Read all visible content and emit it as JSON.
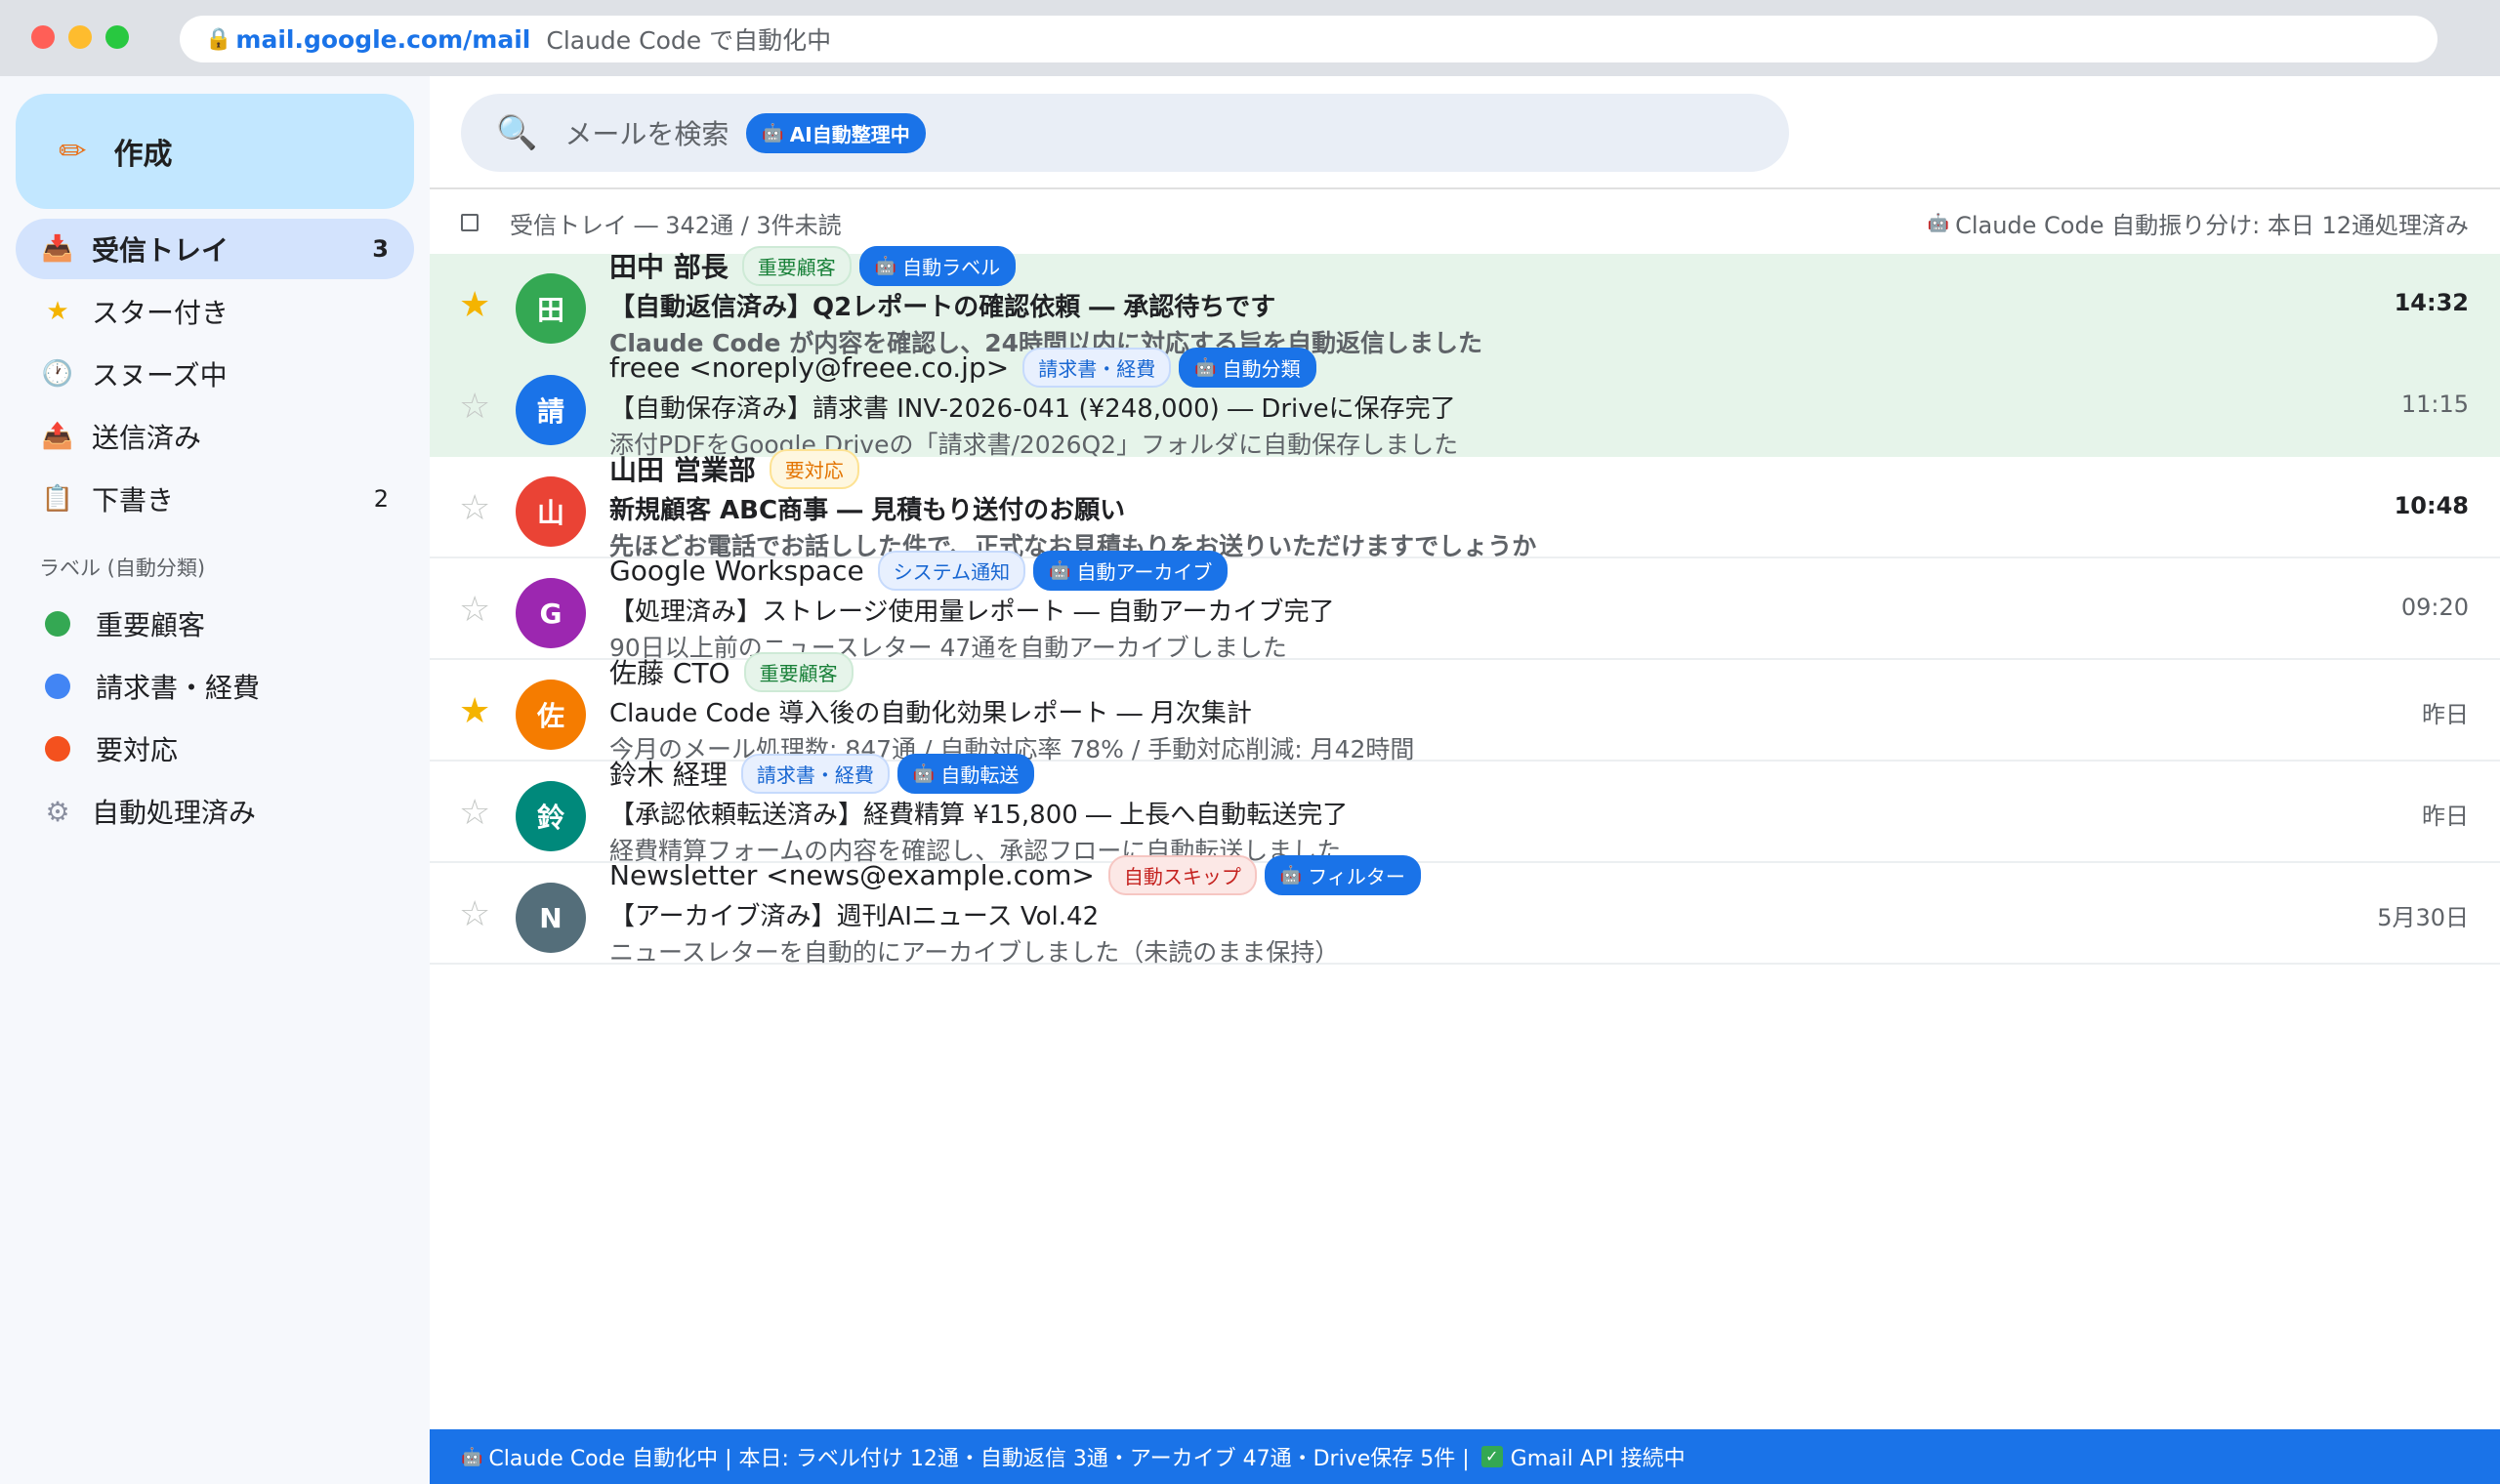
{
  "browser": {
    "url": "mail.google.com/mail",
    "tab_title": "Claude Code で自動化中"
  },
  "sidebar": {
    "compose_label": "作成",
    "nav": [
      {
        "label": "受信トレイ",
        "count": "3",
        "icon": "inbox-icon",
        "active": true
      },
      {
        "label": "スター付き",
        "count": "",
        "icon": "star-icon"
      },
      {
        "label": "スヌーズ中",
        "count": "",
        "icon": "clock-icon"
      },
      {
        "label": "送信済み",
        "count": "",
        "icon": "sent-icon"
      },
      {
        "label": "下書き",
        "count": "2",
        "icon": "draft-icon"
      }
    ],
    "labels_header": "ラベル (自動分類)",
    "labels": [
      {
        "label": "重要顧客",
        "color": "#34a853"
      },
      {
        "label": "請求書・経費",
        "color": "#4285f4"
      },
      {
        "label": "要対応",
        "color": "#f4511e"
      },
      {
        "label": "自動処理済み",
        "icon": "gear-icon"
      }
    ]
  },
  "search": {
    "placeholder": "メールを検索",
    "ai_chip": "AI自動整理中"
  },
  "list": {
    "summary": "受信トレイ ― 342通 / 3件未読",
    "status": "Claude Code 自動振り分け: 本日 12通処理済み"
  },
  "emails": [
    {
      "avatar": "田",
      "avatar_color": "#34a853",
      "starred": true,
      "unread": true,
      "processed": true,
      "sender": "田中 部長",
      "tags": [
        {
          "text": "重要顧客",
          "kind": "green"
        },
        {
          "text": "自動ラベル",
          "kind": "ai"
        }
      ],
      "subject": "【自動返信済み】Q2レポートの確認依頼 ― 承認待ちです",
      "snippet": "Claude Code が内容を確認し、24時間以内に対応する旨を自動返信しました",
      "time": "14:32"
    },
    {
      "avatar": "請",
      "avatar_color": "#1a73e8",
      "starred": false,
      "unread": false,
      "processed": true,
      "sender": "freee <noreply@freee.co.jp>",
      "tags": [
        {
          "text": "請求書・経費",
          "kind": "blue"
        },
        {
          "text": "自動分類",
          "kind": "ai"
        }
      ],
      "subject": "【自動保存済み】請求書 INV-2026-041 (¥248,000) ― Driveに保存完了",
      "snippet": "添付PDFをGoogle Driveの「請求書/2026Q2」フォルダに自動保存しました",
      "time": "11:15"
    },
    {
      "avatar": "山",
      "avatar_color": "#ea4335",
      "starred": false,
      "unread": true,
      "processed": false,
      "sender": "山田 営業部",
      "tags": [
        {
          "text": "要対応",
          "kind": "orange"
        }
      ],
      "subject": "新規顧客 ABC商事 ― 見積もり送付のお願い",
      "snippet": "先ほどお電話でお話しした件で、正式なお見積もりをお送りいただけますでしょうか",
      "time": "10:48"
    },
    {
      "avatar": "G",
      "avatar_color": "#9c27b0",
      "starred": false,
      "unread": false,
      "processed": false,
      "sender": "Google Workspace",
      "tags": [
        {
          "text": "システム通知",
          "kind": "blue"
        },
        {
          "text": "自動アーカイブ",
          "kind": "ai"
        }
      ],
      "subject": "【処理済み】ストレージ使用量レポート ― 自動アーカイブ完了",
      "snippet": "90日以上前のニュースレター 47通を自動アーカイブしました",
      "time": "09:20"
    },
    {
      "avatar": "佐",
      "avatar_color": "#f57c00",
      "starred": true,
      "unread": false,
      "processed": false,
      "sender": "佐藤 CTO",
      "tags": [
        {
          "text": "重要顧客",
          "kind": "green"
        }
      ],
      "subject": "Claude Code 導入後の自動化効果レポート ― 月次集計",
      "snippet": "今月のメール処理数: 847通 / 自動対応率 78% / 手動対応削減: 月42時間",
      "time": "昨日"
    },
    {
      "avatar": "鈴",
      "avatar_color": "#00897b",
      "starred": false,
      "unread": false,
      "processed": false,
      "sender": "鈴木 経理",
      "tags": [
        {
          "text": "請求書・経費",
          "kind": "blue"
        },
        {
          "text": "自動転送",
          "kind": "ai"
        }
      ],
      "subject": "【承認依頼転送済み】経費精算 ¥15,800 ― 上長へ自動転送完了",
      "snippet": "経費精算フォームの内容を確認し、承認フローに自動転送しました",
      "time": "昨日"
    },
    {
      "avatar": "N",
      "avatar_color": "#546e7a",
      "starred": false,
      "unread": false,
      "processed": false,
      "sender": "Newsletter <news@example.com>",
      "tags": [
        {
          "text": "自動スキップ",
          "kind": "red"
        },
        {
          "text": "フィルター",
          "kind": "ai"
        }
      ],
      "subject": "【アーカイブ済み】週刊AIニュース Vol.42",
      "snippet": "ニュースレターを自動的にアーカイブしました（未読のまま保持）",
      "time": "5月30日"
    }
  ],
  "statusbar": {
    "text": "Claude Code 自動化中 | 本日: ラベル付け 12通・自動返信 3通・アーカイブ 47通・Drive保存 5件 |",
    "api": "Gmail API 接続中"
  }
}
